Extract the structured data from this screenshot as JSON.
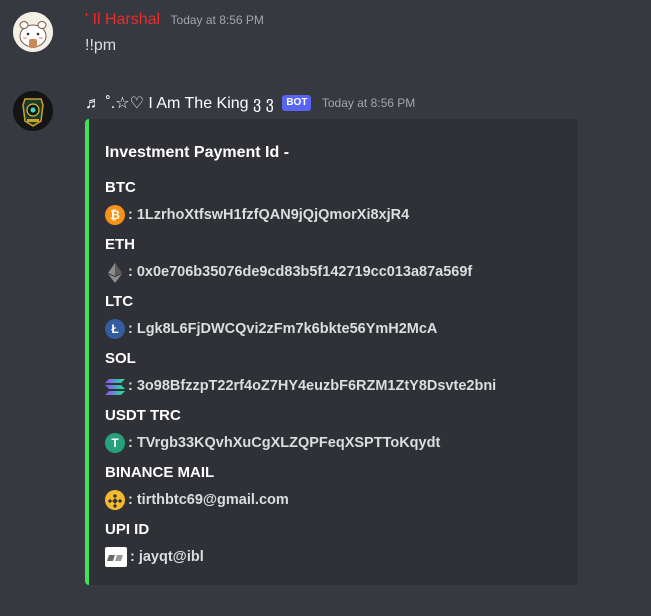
{
  "messages": [
    {
      "username": "' Il Harshal",
      "timestamp": "Today at 8:56 PM",
      "content": "!!pm"
    },
    {
      "username": "♬ ˚.☆♡ I Am The King ვ ვ",
      "bot_tag": "BOT",
      "timestamp": "Today at 8:56 PM",
      "embed": {
        "title": "Investment Payment Id -",
        "accent_color": "#3ce35c",
        "fields": [
          {
            "name": "BTC",
            "icon": "bitcoin-icon",
            "value": "1LzrhoXtfswH1fzfQAN9jQjQmorXi8xjR4"
          },
          {
            "name": "ETH",
            "icon": "ethereum-icon",
            "value": "0x0e706b35076de9cd83b5f142719cc013a87a569f"
          },
          {
            "name": "LTC",
            "icon": "litecoin-icon",
            "value": "Lgk8L6FjDWCQvi2zFm7k6bkte56YmH2McA"
          },
          {
            "name": "SOL",
            "icon": "solana-icon",
            "value": "3o98BfzzpT22rf4oZ7HY4euzbF6RZM1ZtY8Dsvte2bni"
          },
          {
            "name": "USDT TRC",
            "icon": "tether-icon",
            "value": "TVrgb33KQvhXuCgXLZQPFeqXSPTToKqydt"
          },
          {
            "name": "BINANCE MAIL",
            "icon": "binance-icon",
            "value": "tirthbtc69@gmail.com"
          },
          {
            "name": "UPI ID",
            "icon": "upi-icon",
            "value": "jayqt@ibl"
          }
        ]
      }
    }
  ],
  "colors": {
    "background": "#36393f",
    "embed_bg": "#2f3136",
    "bot_tag": "#5865f2",
    "user1": "#ed2b2b"
  }
}
